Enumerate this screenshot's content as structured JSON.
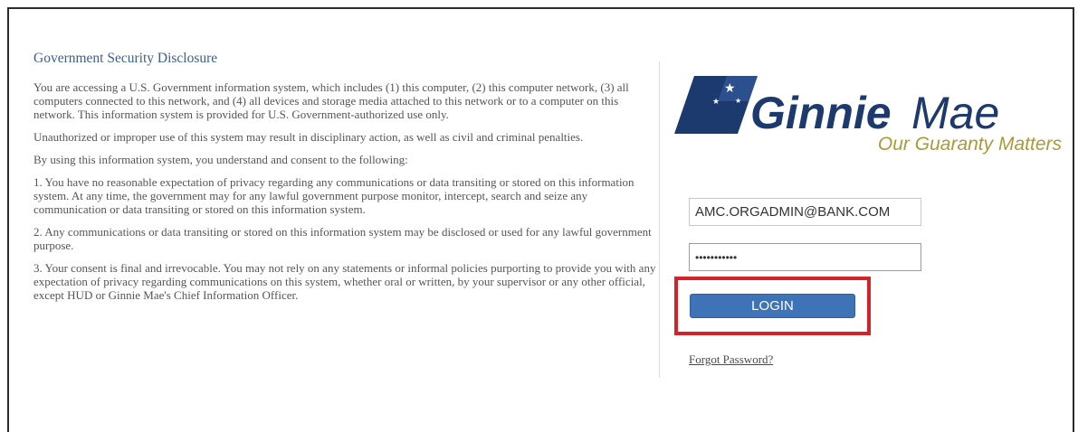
{
  "disclosure": {
    "title": "Government Security Disclosure",
    "paragraphs": [
      "You are accessing a U.S. Government information system, which includes (1) this computer, (2) this computer network, (3) all computers connected to this network, and (4) all devices and storage media attached to this network or to a computer on this network. This information system is provided for U.S. Government-authorized use only.",
      "Unauthorized or improper use of this system may result in disciplinary action, as well as civil and criminal penalties.",
      "By using this information system, you understand and consent to the following:",
      "1. You have no reasonable expectation of privacy regarding any communications or data transiting or stored on this information system. At any time, the government may for any lawful government purpose monitor, intercept, search and seize any communication or data transiting or stored on this information system.",
      "2. Any communications or data transiting or stored on this information system may be disclosed or used for any lawful government purpose.",
      "3. Your consent is final and irrevocable. You may not rely on any statements or informal policies purporting to provide you with any expectation of privacy regarding communications on this system, whether oral or written, by your supervisor or any other official, except HUD or Ginnie Mae's Chief Information Officer."
    ]
  },
  "logo": {
    "name_bold": "Ginnie",
    "name_light": "Mae",
    "tagline": "Our Guaranty Matters",
    "colors": {
      "navy": "#1d3a6e",
      "gold": "#a99a3a"
    }
  },
  "login": {
    "email_value": "AMC.ORGADMIN@BANK.COM",
    "password_value": "•••••••••••",
    "button_label": "LOGIN",
    "forgot_label": "Forgot Password?",
    "highlight_color": "#d2222a"
  }
}
